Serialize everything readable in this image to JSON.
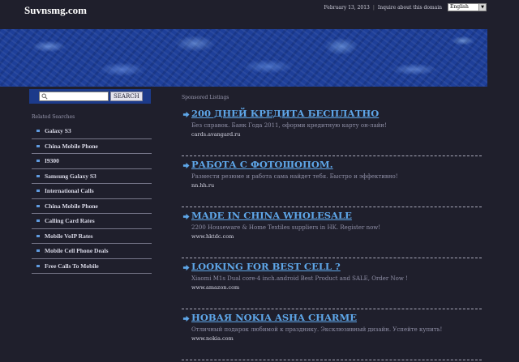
{
  "header": {
    "site_title": "Suvnsmg.com",
    "date": "February 13, 2013",
    "separator": "|",
    "inquire_link": "Inquire about this domain",
    "language_selected": "English"
  },
  "search": {
    "placeholder": "",
    "button_label": "SEARCH"
  },
  "related": {
    "heading": "Related Searches",
    "items": [
      "Galaxy S3",
      "China Mobile Phone",
      "I9300",
      "Samsung Galaxy S3",
      "International Calls",
      "China Mobile Phone",
      "Calling Card Rates",
      "Mobile VoIP Rates",
      "Mobile Cell Phone Deals",
      "Free Calls To Mobile"
    ]
  },
  "sponsored": {
    "heading": "Sponsored Listings",
    "listings": [
      {
        "title": "200 ДНЕЙ КРЕДИТА БЕСПЛАТНО",
        "desc": "Без справок. Банк Года 2011, оформи кредитную карту он-лайн!",
        "url": "cards.avangard.ru"
      },
      {
        "title": "РАБОТА С ФОТОШОПОМ.",
        "desc": "Размести резюме и работа сама найдет тебя. Быстро и эффективно!",
        "url": "nn.hh.ru"
      },
      {
        "title": "MADE IN CHINA WHOLESALE",
        "desc": "2200 Houseware & Home Textiles suppliers in HK. Register now!",
        "url": "www.hktdc.com"
      },
      {
        "title": "LOOKING FOR BEST CELL ?",
        "desc": "Xiaomi M1s Dual core-4 inch.android Best Product and SALE, Order Now !",
        "url": "www.amazon.com"
      },
      {
        "title": "НОВАЯ NOKIA ASHA CHARME",
        "desc": "Отличный подарок любимой к празднику. Эксклюзивный дизайн. Успейте купить!",
        "url": "www.nokia.com"
      }
    ]
  },
  "colors": {
    "background": "#1f1f2c",
    "banner": "#1e3f99",
    "link": "#5ea6e8",
    "bullet": "#5f9be0"
  }
}
